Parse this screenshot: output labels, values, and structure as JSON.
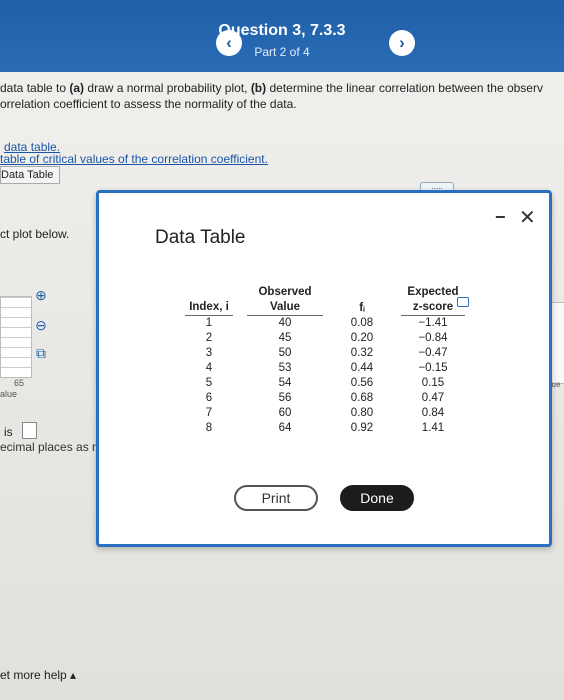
{
  "header": {
    "title": "Question 3, 7.3.3",
    "subtitle": "Part 2 of 4",
    "prev_label": "‹",
    "next_label": "›"
  },
  "background": {
    "instruction_line1_a": "data table to ",
    "instruction_line1_b": "(a)",
    "instruction_line1_c": " draw a normal probability plot, ",
    "instruction_line1_d": "(b)",
    "instruction_line1_e": " determine the linear correlation between the observ",
    "instruction_line2": "orrelation coefficient to assess the normality of the data.",
    "link_data_table": "data table.",
    "link_critical": "table of critical values of the correlation coefficient.",
    "tab_data_table": "Data Table",
    "plot_text": "ct plot below.",
    "axis_value": "65",
    "axis_label": "alue",
    "is_label": "is",
    "decimal_text": "ecimal places as need",
    "help_text": "et more help ▴",
    "right_label": "llue",
    "dots_label": "....."
  },
  "modal": {
    "title": "Data Table",
    "minimize_label": "−",
    "close_label": "✕",
    "columns": {
      "index_line1": "",
      "index_line2": "Index, i",
      "obs_line1": "Observed",
      "obs_line2": "Value",
      "fi": "fᵢ",
      "z_line1": "Expected",
      "z_line2": "z-score"
    },
    "rows": [
      {
        "index": "1",
        "value": "40",
        "fi": "0.08",
        "z": "−1.41"
      },
      {
        "index": "2",
        "value": "45",
        "fi": "0.20",
        "z": "−0.84"
      },
      {
        "index": "3",
        "value": "50",
        "fi": "0.32",
        "z": "−0.47"
      },
      {
        "index": "4",
        "value": "53",
        "fi": "0.44",
        "z": "−0.15"
      },
      {
        "index": "5",
        "value": "54",
        "fi": "0.56",
        "z": "0.15"
      },
      {
        "index": "6",
        "value": "56",
        "fi": "0.68",
        "z": "0.47"
      },
      {
        "index": "7",
        "value": "60",
        "fi": "0.80",
        "z": "0.84"
      },
      {
        "index": "8",
        "value": "64",
        "fi": "0.92",
        "z": "1.41"
      }
    ],
    "print_label": "Print",
    "done_label": "Done"
  },
  "icons": {
    "zoom_in": "⊕",
    "zoom_out": "⊖",
    "popout": "⧉"
  }
}
